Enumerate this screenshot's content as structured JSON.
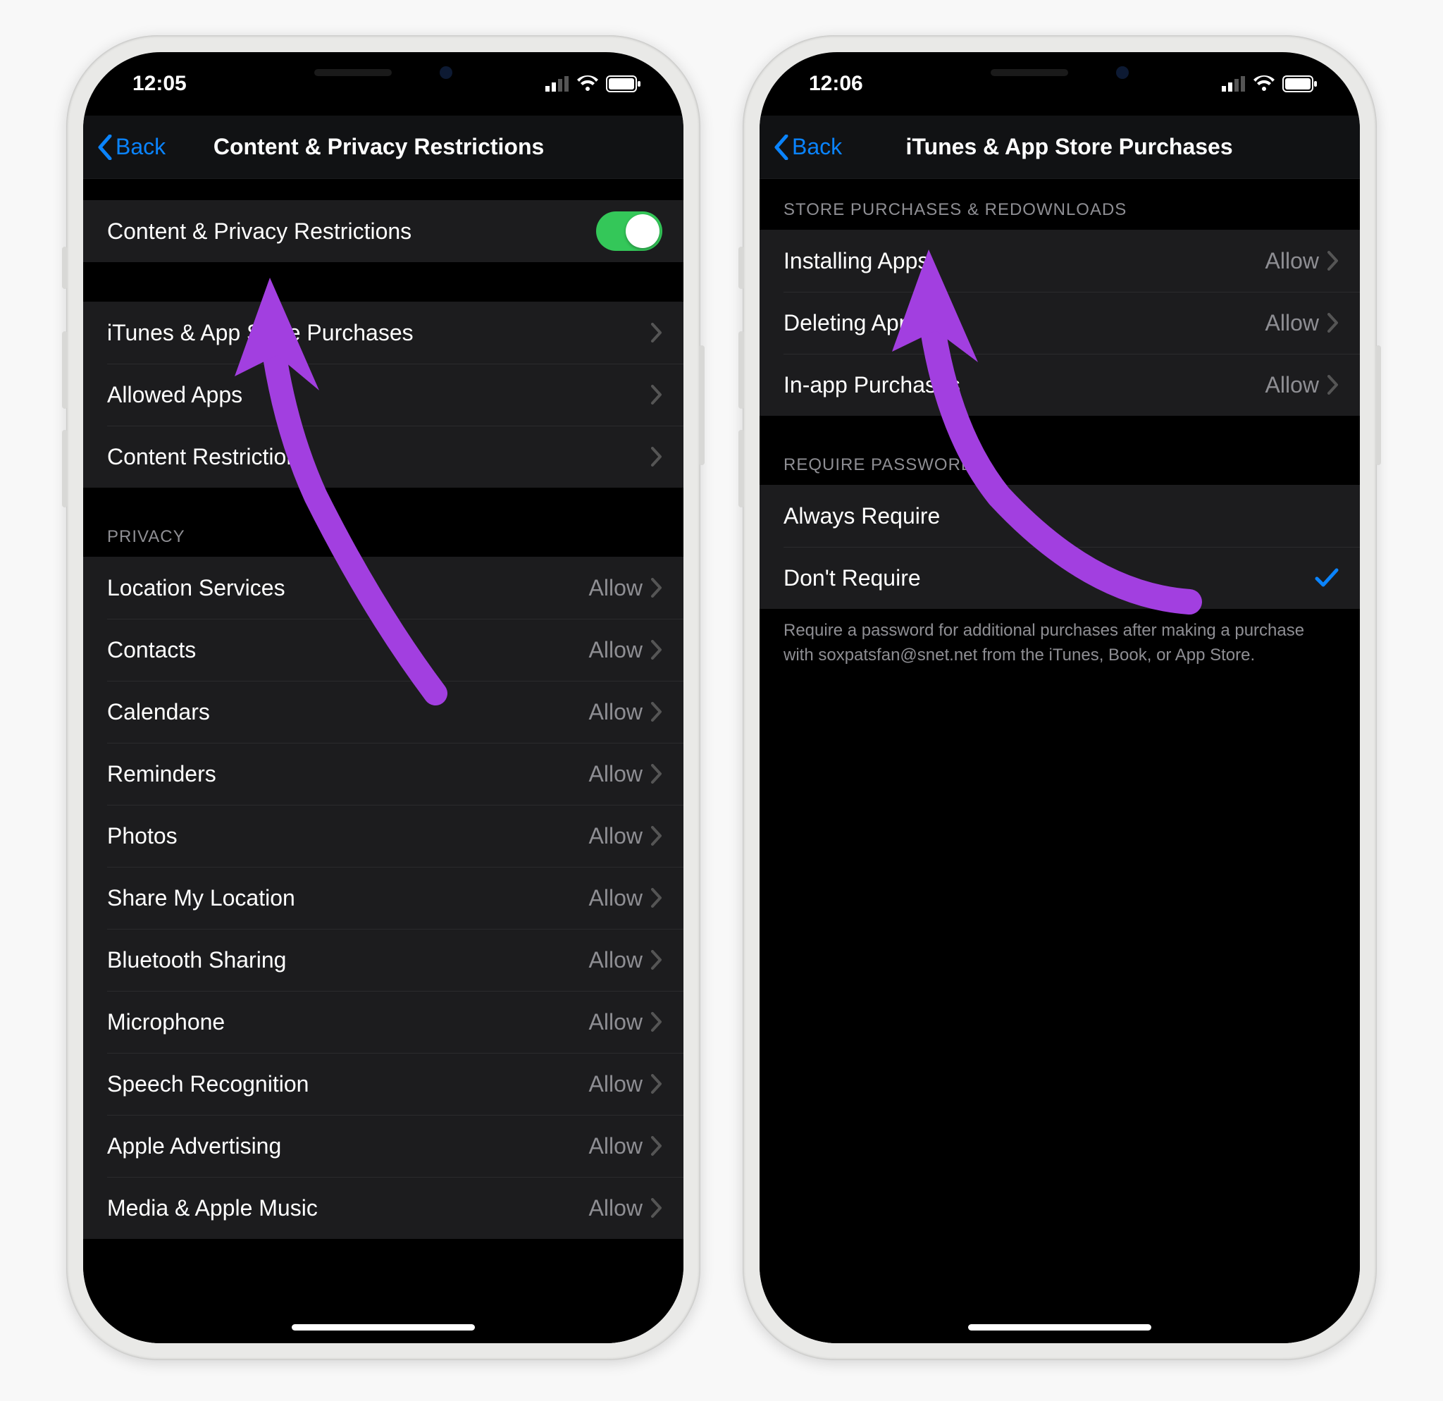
{
  "left": {
    "status_time": "12:05",
    "back_label": "Back",
    "title": "Content & Privacy Restrictions",
    "toggle_row": {
      "label": "Content & Privacy Restrictions"
    },
    "main_rows": [
      {
        "label": "iTunes & App Store Purchases"
      },
      {
        "label": "Allowed Apps"
      },
      {
        "label": "Content Restrictions"
      }
    ],
    "privacy_header": "PRIVACY",
    "privacy_rows": [
      {
        "label": "Location Services",
        "value": "Allow"
      },
      {
        "label": "Contacts",
        "value": "Allow"
      },
      {
        "label": "Calendars",
        "value": "Allow"
      },
      {
        "label": "Reminders",
        "value": "Allow"
      },
      {
        "label": "Photos",
        "value": "Allow"
      },
      {
        "label": "Share My Location",
        "value": "Allow"
      },
      {
        "label": "Bluetooth Sharing",
        "value": "Allow"
      },
      {
        "label": "Microphone",
        "value": "Allow"
      },
      {
        "label": "Speech Recognition",
        "value": "Allow"
      },
      {
        "label": "Apple Advertising",
        "value": "Allow"
      },
      {
        "label": "Media & Apple Music",
        "value": "Allow"
      }
    ]
  },
  "right": {
    "status_time": "12:06",
    "back_label": "Back",
    "title": "iTunes & App Store Purchases",
    "store_header": "STORE PURCHASES & REDOWNLOADS",
    "store_rows": [
      {
        "label": "Installing Apps",
        "value": "Allow"
      },
      {
        "label": "Deleting Apps",
        "value": "Allow"
      },
      {
        "label": "In-app Purchases",
        "value": "Allow"
      }
    ],
    "password_header": "REQUIRE PASSWORD",
    "password_rows": [
      {
        "label": "Always Require",
        "checked": false
      },
      {
        "label": "Don't Require",
        "checked": true
      }
    ],
    "password_footer": "Require a password for additional purchases after making a purchase with soxpatsfan@snet.net from the iTunes, Book, or App Store."
  },
  "annotation_color": "#a23fe0"
}
